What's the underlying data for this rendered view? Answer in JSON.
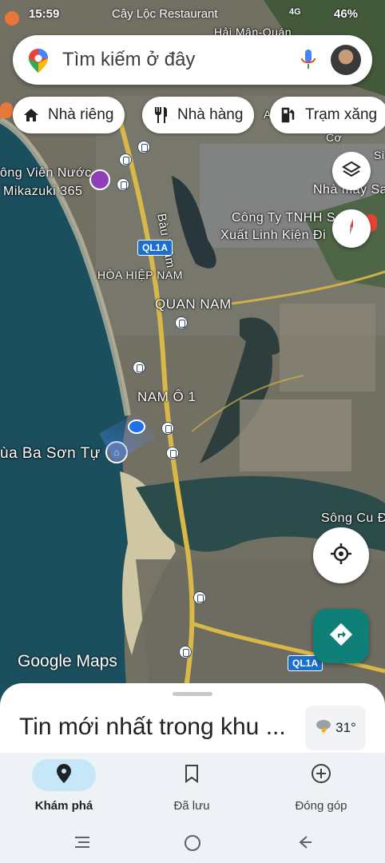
{
  "status_bar": {
    "time": "15:59",
    "place_text": "Cây Lộc Restaurant",
    "network": "4G",
    "battery": "46%"
  },
  "search": {
    "placeholder": "Tìm kiếm ở đây",
    "icon": "maps-pin-icon",
    "mic_icon": "mic-icon"
  },
  "chips": [
    {
      "label": "Nhà riêng",
      "icon": "home-icon"
    },
    {
      "label": "Nhà hàng",
      "icon": "restaurant-icon"
    },
    {
      "label": "Trạm xăng",
      "icon": "gas-station-icon"
    }
  ],
  "map_labels": {
    "hai_man": "Hải Mận-Quán",
    "cong_vien": "ông Viên Nước",
    "mikazuki": "Mikazuki 365",
    "nha_may": "Nhà máy Sa",
    "bau_tram": "Bàu Tràm",
    "cong_ty": "Công Ty TNHH S",
    "xuat_linh": "Xuất Linh Kiện Đi",
    "hoa_hiep": "HÒA HIỆP NAM",
    "quan_nam": "QUAN NAM",
    "nam_o": "NAM Ô 1",
    "chua": "ùa Ba Sơn Tự",
    "song_cu": "Sông Cu Đê",
    "co": "Cơ",
    "si": "Si",
    "a": "A"
  },
  "road_shields": {
    "top": "QL1A",
    "bottom": "QL1A"
  },
  "map_logo": "Google Maps",
  "sheet": {
    "title": "Tin mới nhất trong khu ...",
    "temperature": "31°"
  },
  "nav": [
    {
      "label": "Khám phá",
      "icon": "explore-pin-icon",
      "active": true
    },
    {
      "label": "Đã lưu",
      "icon": "bookmark-icon",
      "active": false
    },
    {
      "label": "Đóng góp",
      "icon": "add-circle-icon",
      "active": false
    }
  ],
  "colors": {
    "accent_teal": "#0f8077",
    "active_pill": "#c5e7f7",
    "nav_bg": "#eef1f6"
  }
}
